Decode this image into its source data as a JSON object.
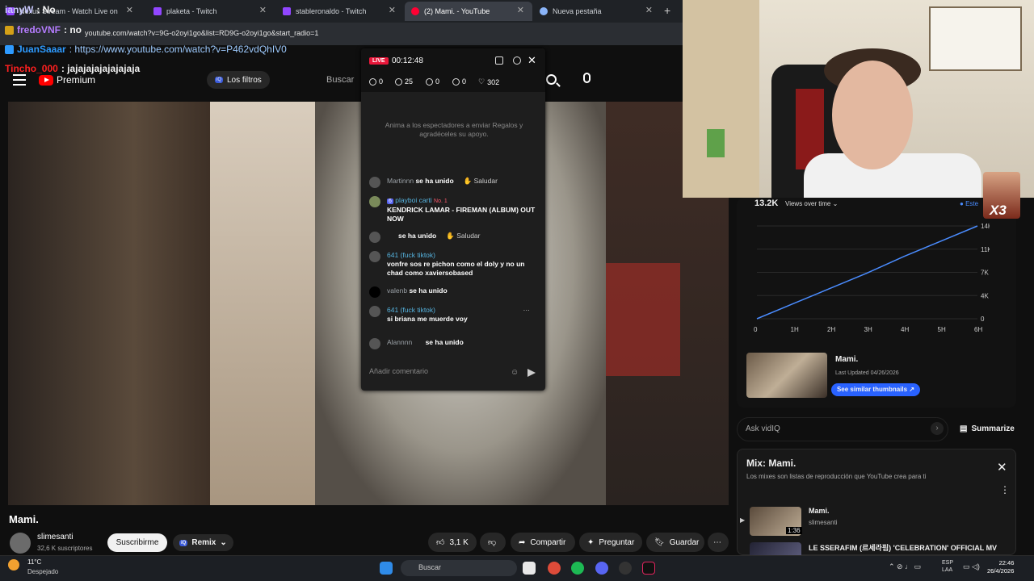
{
  "browser": {
    "tabs": [
      {
        "label": "Nexus Stream - Watch Live on",
        "color": "#9146ff"
      },
      {
        "label": "plaketa - Twitch",
        "color": "#9146ff"
      },
      {
        "label": "stableronaldo - Twitch",
        "color": "#9146ff"
      },
      {
        "label": "(2) Mami. - YouTube",
        "color": "#ff0033"
      },
      {
        "label": "Nueva pestaña",
        "color": "#8ab4f8"
      }
    ],
    "url": "youtube.com/watch?v=9G-o2oyi1go&list=RD9G-o2oyi1go&start_radio=1"
  },
  "overlay_chat": [
    {
      "user": "ianyW",
      "text": ": No",
      "color": "#c9c9ff",
      "badge": "#7a5cff"
    },
    {
      "user": "fredoVNF",
      "text": ": no",
      "color": "#b57cff",
      "badge": "#d4a017"
    },
    {
      "user": "JuanSaaar",
      "text": ": https://www.youtube.com/watch?v=P462vdQhIV0",
      "color": "#2e9bff",
      "badge": "#2e9bff"
    },
    {
      "user": "Tincho_000",
      "text": ": jajajajajajajajaja",
      "color": "#ff2020",
      "badge": ""
    }
  ],
  "youtube": {
    "logo": "Premium",
    "filters": "Los filtros",
    "search_placeholder": "Buscar",
    "video_title": "Mami.",
    "channel": "slimesanti",
    "subscribers": "32,6 K suscriptores",
    "subscribe": "Suscribirme",
    "remix": "Remix",
    "likes": "3,1 K",
    "share": "Compartir",
    "ask": "Preguntar",
    "save": "Guardar"
  },
  "live_panel": {
    "badge": "LIVE",
    "timer": "00:12:48",
    "stats": [
      "0",
      "25",
      "0",
      "0",
      "302"
    ],
    "promo": "Anima a los espectadores a enviar Regalos y agradéceles su apoyo.",
    "messages": [
      {
        "user": "Martinnn",
        "text": "se ha unido",
        "action": "Saludar"
      },
      {
        "user": "playboi carti",
        "text": "KENDRICK LAMAR - FIREMAN (ALBUM) OUT NOW",
        "tag": "No. 1",
        "level": "6"
      },
      {
        "user": "",
        "text": "se ha unido",
        "action": "Saludar"
      },
      {
        "user": "641 (fuck tiktok)",
        "text": "vonfre sos re pichon como el doly y no un chad como xaviersobased"
      },
      {
        "user": "valenb",
        "text": "se ha unido"
      },
      {
        "user": "641 (fuck tiktok)",
        "text": "si briana me muerde voy"
      },
      {
        "user": "Alannnn",
        "text": "se ha unido"
      }
    ],
    "comment_placeholder": "Añadir comentario"
  },
  "analytics": {
    "views": "13.2K",
    "metric": "Views over time",
    "legend": "Este",
    "card_title": "Mami.",
    "last_updated": "Last Updated 04/26/2026",
    "similar": "See similar thumbnails"
  },
  "chart_data": {
    "type": "line",
    "x": [
      "0",
      "1H",
      "2H",
      "3H",
      "4H",
      "5H",
      "6H"
    ],
    "yticks": [
      "0",
      "4K",
      "7K",
      "11K",
      "14K"
    ],
    "series": [
      {
        "name": "Este",
        "values": [
          0,
          2300,
          4600,
          6900,
          9400,
          11700,
          14000
        ]
      }
    ],
    "ylim": [
      0,
      14000
    ],
    "color": "#4a8cff"
  },
  "ask_bar": {
    "placeholder": "Ask vidIQ",
    "summarize": "Summarize"
  },
  "mix": {
    "title": "Mix: Mami.",
    "subtitle": "Los mixes son listas de reproducción que YouTube crea para ti",
    "items": [
      {
        "title": "Mami.",
        "channel": "slimesanti",
        "duration": "1:36"
      },
      {
        "title": "LE SSERAFIM (르세라핌) 'CELEBRATION' OFFICIAL MV",
        "channel": "",
        "duration": ""
      }
    ]
  },
  "emote": {
    "text": "X3"
  },
  "taskbar": {
    "temp": "11°C",
    "weather": "Despejado",
    "search": "Buscar",
    "lang1": "ESP",
    "lang2": "LAA",
    "time": "22:46",
    "date": "26/4/2026"
  }
}
